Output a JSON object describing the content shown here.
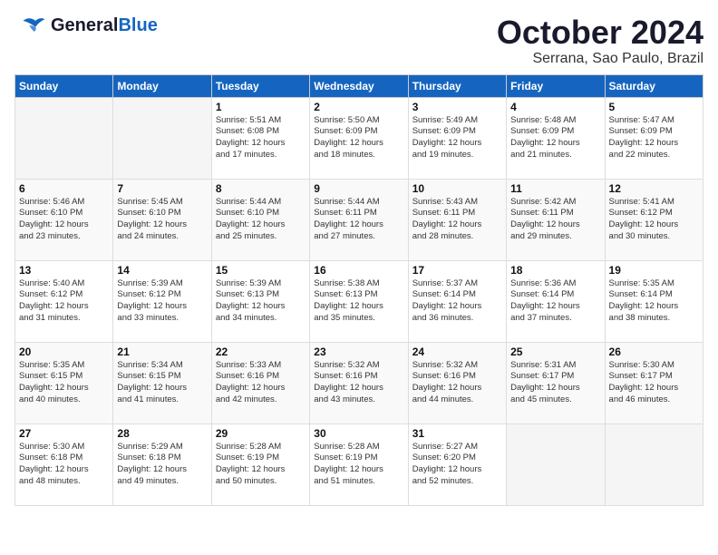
{
  "header": {
    "logo_line1": "General",
    "logo_line2": "Blue",
    "month": "October 2024",
    "location": "Serrana, Sao Paulo, Brazil"
  },
  "weekdays": [
    "Sunday",
    "Monday",
    "Tuesday",
    "Wednesday",
    "Thursday",
    "Friday",
    "Saturday"
  ],
  "weeks": [
    [
      {
        "day": "",
        "info": ""
      },
      {
        "day": "",
        "info": ""
      },
      {
        "day": "1",
        "info": "Sunrise: 5:51 AM\nSunset: 6:08 PM\nDaylight: 12 hours\nand 17 minutes."
      },
      {
        "day": "2",
        "info": "Sunrise: 5:50 AM\nSunset: 6:09 PM\nDaylight: 12 hours\nand 18 minutes."
      },
      {
        "day": "3",
        "info": "Sunrise: 5:49 AM\nSunset: 6:09 PM\nDaylight: 12 hours\nand 19 minutes."
      },
      {
        "day": "4",
        "info": "Sunrise: 5:48 AM\nSunset: 6:09 PM\nDaylight: 12 hours\nand 21 minutes."
      },
      {
        "day": "5",
        "info": "Sunrise: 5:47 AM\nSunset: 6:09 PM\nDaylight: 12 hours\nand 22 minutes."
      }
    ],
    [
      {
        "day": "6",
        "info": "Sunrise: 5:46 AM\nSunset: 6:10 PM\nDaylight: 12 hours\nand 23 minutes."
      },
      {
        "day": "7",
        "info": "Sunrise: 5:45 AM\nSunset: 6:10 PM\nDaylight: 12 hours\nand 24 minutes."
      },
      {
        "day": "8",
        "info": "Sunrise: 5:44 AM\nSunset: 6:10 PM\nDaylight: 12 hours\nand 25 minutes."
      },
      {
        "day": "9",
        "info": "Sunrise: 5:44 AM\nSunset: 6:11 PM\nDaylight: 12 hours\nand 27 minutes."
      },
      {
        "day": "10",
        "info": "Sunrise: 5:43 AM\nSunset: 6:11 PM\nDaylight: 12 hours\nand 28 minutes."
      },
      {
        "day": "11",
        "info": "Sunrise: 5:42 AM\nSunset: 6:11 PM\nDaylight: 12 hours\nand 29 minutes."
      },
      {
        "day": "12",
        "info": "Sunrise: 5:41 AM\nSunset: 6:12 PM\nDaylight: 12 hours\nand 30 minutes."
      }
    ],
    [
      {
        "day": "13",
        "info": "Sunrise: 5:40 AM\nSunset: 6:12 PM\nDaylight: 12 hours\nand 31 minutes."
      },
      {
        "day": "14",
        "info": "Sunrise: 5:39 AM\nSunset: 6:12 PM\nDaylight: 12 hours\nand 33 minutes."
      },
      {
        "day": "15",
        "info": "Sunrise: 5:39 AM\nSunset: 6:13 PM\nDaylight: 12 hours\nand 34 minutes."
      },
      {
        "day": "16",
        "info": "Sunrise: 5:38 AM\nSunset: 6:13 PM\nDaylight: 12 hours\nand 35 minutes."
      },
      {
        "day": "17",
        "info": "Sunrise: 5:37 AM\nSunset: 6:14 PM\nDaylight: 12 hours\nand 36 minutes."
      },
      {
        "day": "18",
        "info": "Sunrise: 5:36 AM\nSunset: 6:14 PM\nDaylight: 12 hours\nand 37 minutes."
      },
      {
        "day": "19",
        "info": "Sunrise: 5:35 AM\nSunset: 6:14 PM\nDaylight: 12 hours\nand 38 minutes."
      }
    ],
    [
      {
        "day": "20",
        "info": "Sunrise: 5:35 AM\nSunset: 6:15 PM\nDaylight: 12 hours\nand 40 minutes."
      },
      {
        "day": "21",
        "info": "Sunrise: 5:34 AM\nSunset: 6:15 PM\nDaylight: 12 hours\nand 41 minutes."
      },
      {
        "day": "22",
        "info": "Sunrise: 5:33 AM\nSunset: 6:16 PM\nDaylight: 12 hours\nand 42 minutes."
      },
      {
        "day": "23",
        "info": "Sunrise: 5:32 AM\nSunset: 6:16 PM\nDaylight: 12 hours\nand 43 minutes."
      },
      {
        "day": "24",
        "info": "Sunrise: 5:32 AM\nSunset: 6:16 PM\nDaylight: 12 hours\nand 44 minutes."
      },
      {
        "day": "25",
        "info": "Sunrise: 5:31 AM\nSunset: 6:17 PM\nDaylight: 12 hours\nand 45 minutes."
      },
      {
        "day": "26",
        "info": "Sunrise: 5:30 AM\nSunset: 6:17 PM\nDaylight: 12 hours\nand 46 minutes."
      }
    ],
    [
      {
        "day": "27",
        "info": "Sunrise: 5:30 AM\nSunset: 6:18 PM\nDaylight: 12 hours\nand 48 minutes."
      },
      {
        "day": "28",
        "info": "Sunrise: 5:29 AM\nSunset: 6:18 PM\nDaylight: 12 hours\nand 49 minutes."
      },
      {
        "day": "29",
        "info": "Sunrise: 5:28 AM\nSunset: 6:19 PM\nDaylight: 12 hours\nand 50 minutes."
      },
      {
        "day": "30",
        "info": "Sunrise: 5:28 AM\nSunset: 6:19 PM\nDaylight: 12 hours\nand 51 minutes."
      },
      {
        "day": "31",
        "info": "Sunrise: 5:27 AM\nSunset: 6:20 PM\nDaylight: 12 hours\nand 52 minutes."
      },
      {
        "day": "",
        "info": ""
      },
      {
        "day": "",
        "info": ""
      }
    ]
  ]
}
